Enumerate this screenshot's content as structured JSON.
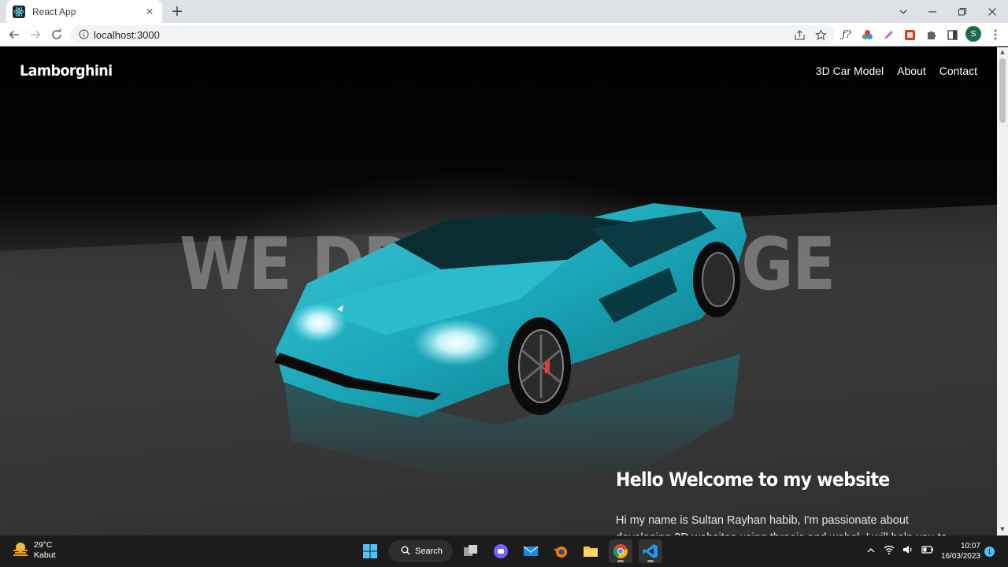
{
  "browser": {
    "tab_title": "React App",
    "url": "localhost:3000",
    "profile_initial": "S"
  },
  "site": {
    "brand": "Lamborghini",
    "nav": [
      "3D Car Model",
      "About",
      "Contact"
    ],
    "hero_text": "WE DRIVE CHANGE",
    "welcome_title": "Hello Welcome to my website",
    "welcome_body": "Hi my name is Sultan Rayhan habib, I'm passionate about developing 3D websites using threejs and webgl. I will help you to create an",
    "car_color": "#1aa6b8"
  },
  "taskbar": {
    "temperature": "29°C",
    "weather": "Kabut",
    "search_label": "Search",
    "time": "10:07",
    "date": "16/03/2023",
    "notification_count": "1"
  }
}
